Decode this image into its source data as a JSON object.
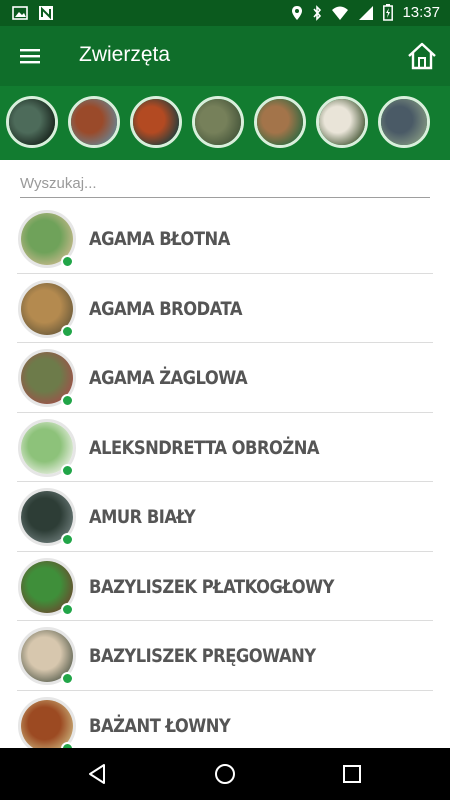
{
  "status_bar": {
    "time": "13:37",
    "icons_left": [
      "image-icon",
      "n-icon"
    ],
    "icons_right": [
      "location-icon",
      "bluetooth-icon",
      "wifi-icon",
      "signal-icon",
      "battery-icon"
    ]
  },
  "app_bar": {
    "title": "Zwierzęta",
    "menu_icon": "menu-icon",
    "home_icon": "home-icon"
  },
  "bird_strip": [
    {
      "name": "bird-1",
      "colors": [
        "#4d6b5a",
        "#1d2a22"
      ]
    },
    {
      "name": "bird-2",
      "colors": [
        "#9a4a2a",
        "#6f7d86"
      ]
    },
    {
      "name": "bird-3",
      "colors": [
        "#b34a22",
        "#2f3f3b"
      ]
    },
    {
      "name": "bird-4",
      "colors": [
        "#76805a",
        "#4b5a3e"
      ]
    },
    {
      "name": "bird-5",
      "colors": [
        "#a3744a",
        "#3c6a42"
      ]
    },
    {
      "name": "bird-6",
      "colors": [
        "#e9e4d8",
        "#5c6a4c"
      ]
    },
    {
      "name": "bird-7",
      "colors": [
        "#4a5a66",
        "#7c8f7e"
      ]
    }
  ],
  "search": {
    "placeholder": "Wyszukaj..."
  },
  "animals": [
    {
      "label": "AGAMA BŁOTNA",
      "colors": [
        "#6fa25a",
        "#c7b98c"
      ]
    },
    {
      "label": "AGAMA BRODATA",
      "colors": [
        "#b48a4f",
        "#6a5a3a"
      ]
    },
    {
      "label": "AGAMA ŻAGLOWA",
      "colors": [
        "#6d7b4a",
        "#a0504a"
      ]
    },
    {
      "label": "ALEKSNDRETTA OBROŻNA",
      "colors": [
        "#8dc27a",
        "#e9efe2"
      ]
    },
    {
      "label": "AMUR BIAŁY",
      "colors": [
        "#2d3d36",
        "#6b7a78"
      ]
    },
    {
      "label": "BAZYLISZEK PŁATKOGŁOWY",
      "colors": [
        "#3f8f3a",
        "#6a4a2e"
      ]
    },
    {
      "label": "BAZYLISZEK PRĘGOWANY",
      "colors": [
        "#d7c7ae",
        "#5a6050"
      ]
    },
    {
      "label": "BAŻANT ŁOWNY",
      "colors": [
        "#9c4a22",
        "#c9b07a"
      ]
    }
  ],
  "online_color": "#21a548",
  "nav_bar": {
    "buttons": [
      "back-icon",
      "home-circle-icon",
      "recents-icon"
    ]
  }
}
